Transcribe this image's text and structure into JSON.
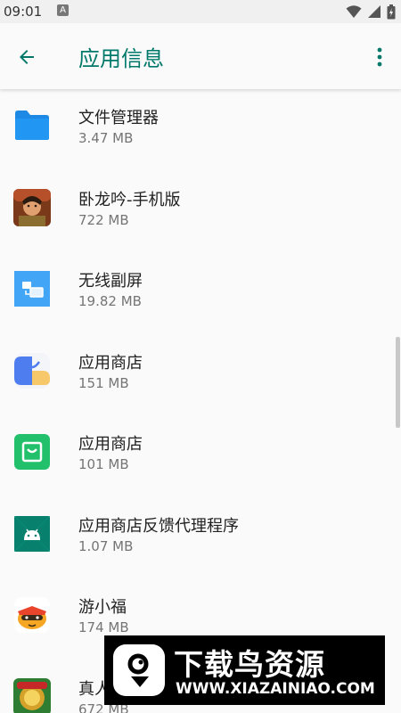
{
  "status_bar": {
    "time": "09:01",
    "notification_icon": "A",
    "icons": [
      "wifi-icon",
      "signal-icon",
      "battery-icon"
    ]
  },
  "header": {
    "title": "应用信息",
    "back_icon": "arrow-back-icon",
    "menu_icon": "more-vert-icon",
    "accent_color": "#00796b"
  },
  "apps": [
    {
      "name": "文件管理器",
      "size": "3.47 MB",
      "icon": "folder-icon"
    },
    {
      "name": "卧龙吟-手机版",
      "size": "722 MB",
      "icon": "game-warrior-icon"
    },
    {
      "name": "无线副屏",
      "size": "19.82 MB",
      "icon": "screen-mirror-icon"
    },
    {
      "name": "应用商店",
      "size": "151 MB",
      "icon": "shopping-bag-icon"
    },
    {
      "name": "应用商店",
      "size": "101 MB",
      "icon": "store-bag-icon"
    },
    {
      "name": "应用商店反馈代理程序",
      "size": "1.07 MB",
      "icon": "android-icon"
    },
    {
      "name": "游小福",
      "size": "174 MB",
      "icon": "mascot-icon"
    },
    {
      "name": "真人",
      "size": "672 MB",
      "icon": "game-gold-icon"
    }
  ],
  "watermark": {
    "title": "下载鸟资源",
    "url": "WWW.XIAZAINIAO.COM"
  }
}
